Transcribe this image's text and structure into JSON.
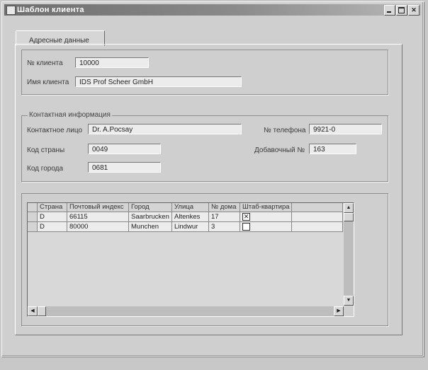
{
  "window": {
    "title": "Шаблон клиента"
  },
  "tabs": [
    {
      "label": "Адресные данные"
    }
  ],
  "client": {
    "number_label": "№ клиента",
    "number_value": "10000",
    "name_label": "Имя клиента",
    "name_value": "IDS Prof Scheer GmbH"
  },
  "contact": {
    "legend": "Контактная информация",
    "person_label": "Контактное лицо",
    "person_value": "Dr. A.Pocsay",
    "phone_label": "№ телефона",
    "phone_value": "9921-0",
    "country_code_label": "Код страны",
    "country_code_value": "0049",
    "ext_label": "Добавочный №",
    "ext_value": "163",
    "city_code_label": "Код города",
    "city_code_value": "0681"
  },
  "table": {
    "columns": [
      "Страна",
      "Почтовый индекс",
      "Город",
      "Улица",
      "№ дома",
      "Штаб-квартира"
    ],
    "rows": [
      {
        "country": "D",
        "zip": "66115",
        "city": "Saarbrucken",
        "street": "Altenkes",
        "house": "17",
        "hq": true
      },
      {
        "country": "D",
        "zip": "80000",
        "city": "Munchen",
        "street": "Lindwur",
        "house": "3",
        "hq": false
      }
    ]
  }
}
